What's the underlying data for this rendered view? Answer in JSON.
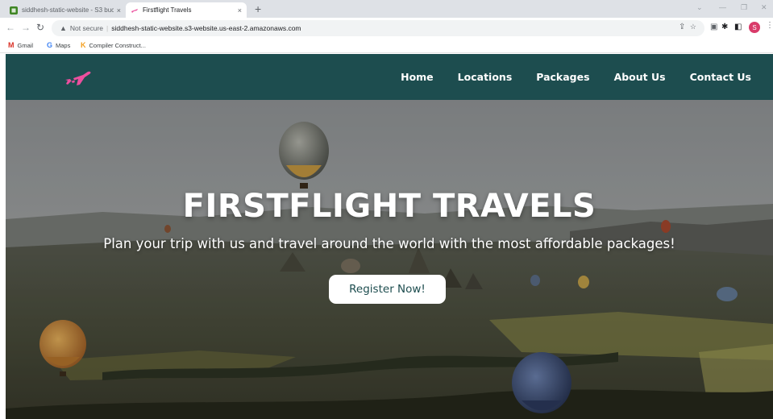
{
  "browser": {
    "tabs": [
      {
        "title": "siddhesh-static-website - S3 buck",
        "active": false
      },
      {
        "title": "Firstflight Travels",
        "active": true
      }
    ],
    "new_tab": "+",
    "tab_close": "×",
    "address": {
      "security": "Not secure",
      "url": "siddhesh-static-website.s3-website.us-east-2.amazonaws.com"
    },
    "profile_initial": "S",
    "bookmarks": [
      {
        "label": "Gmail",
        "icon": "gmail-icon"
      },
      {
        "label": "Maps",
        "icon": "google-icon"
      },
      {
        "label": "Compiler Construct...",
        "icon": "compiler-icon"
      }
    ]
  },
  "site": {
    "logo": "plane-logo-icon",
    "nav": [
      "Home",
      "Locations",
      "Packages",
      "About Us",
      "Contact Us"
    ],
    "hero": {
      "title": "FIRSTFLIGHT TRAVELS",
      "subtitle": "Plan your trip with us and travel around the world with the most affordable packages!",
      "cta": "Register Now!"
    }
  },
  "colors": {
    "nav_bg": "#1d4d4f",
    "logo": "#ec4f9e",
    "cta_text": "#1d4d4f"
  }
}
